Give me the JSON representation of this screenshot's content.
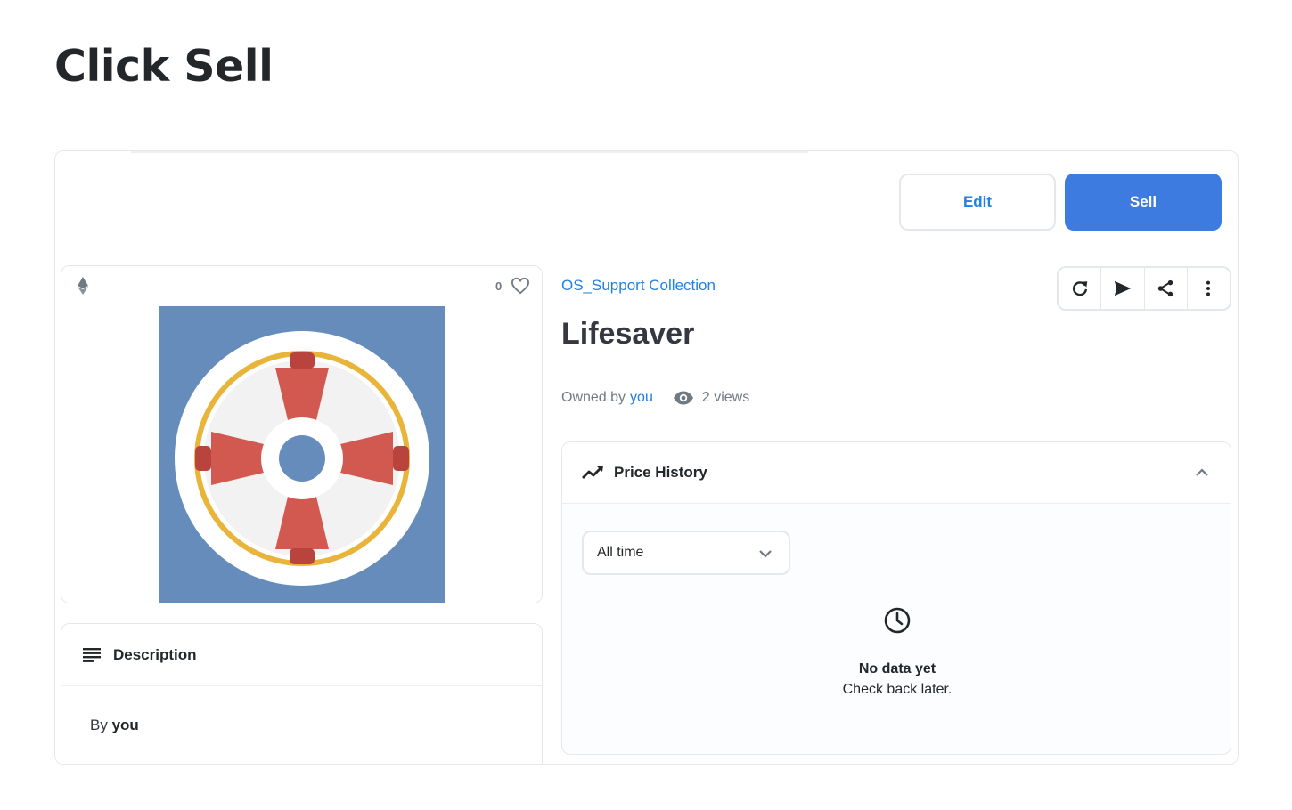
{
  "instruction": "Click Sell",
  "actions": {
    "edit_label": "Edit",
    "sell_label": "Sell"
  },
  "media": {
    "favorite_count": "0",
    "image_subject": "lifebuoy"
  },
  "item": {
    "collection": "OS_Support Collection",
    "title": "Lifesaver",
    "owned_by_label": "Owned by",
    "owner": "you",
    "views": "2 views"
  },
  "toolbar_icons": [
    "refresh-icon",
    "send-icon",
    "share-icon",
    "more-icon"
  ],
  "description": {
    "title": "Description",
    "by_label": "By",
    "author": "you"
  },
  "price_history": {
    "title": "Price History",
    "period_selected": "All time",
    "empty_title": "No data yet",
    "empty_subtitle": "Check back later."
  },
  "colors": {
    "accent": "#2081e2",
    "sell_button": "#3d7be0",
    "image_background": "#668cbb",
    "buoy_red": "#d2594f",
    "buoy_ring": "#e9b43a"
  }
}
